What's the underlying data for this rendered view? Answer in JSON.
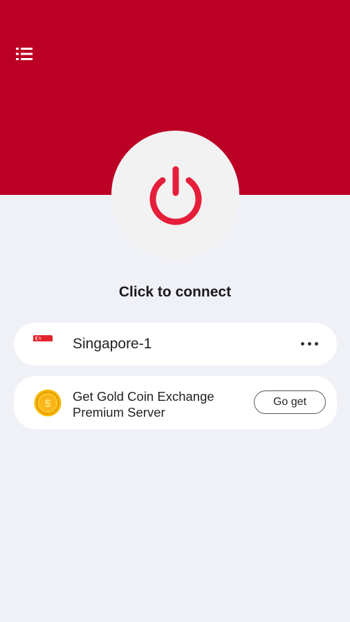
{
  "header": {
    "menu_icon": "list-menu-icon",
    "background_color": "#bc0025"
  },
  "power": {
    "icon": "power-icon",
    "icon_color": "#e51e3a",
    "status_text": "Click to connect"
  },
  "server": {
    "name": "Singapore-1",
    "flag_icon": "singapore-flag-icon",
    "more_icon": "more-horizontal-icon"
  },
  "promo": {
    "icon": "gold-coin-icon",
    "line1": "Get Gold Coin Exchange",
    "line2": "Premium Server",
    "button_label": "Go get"
  }
}
